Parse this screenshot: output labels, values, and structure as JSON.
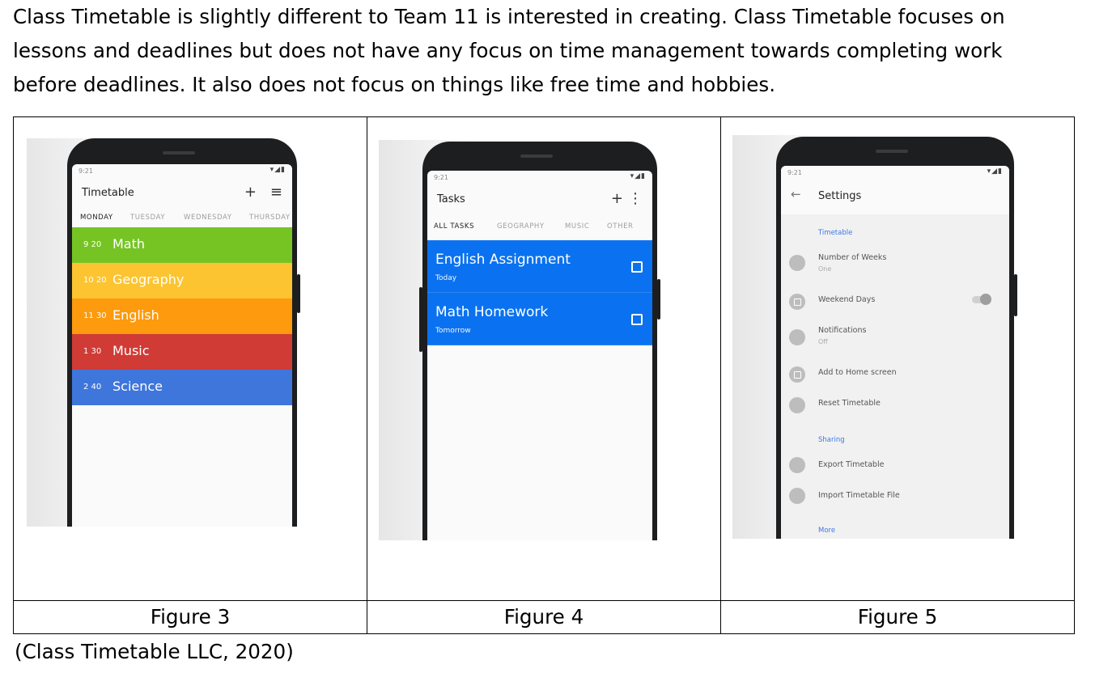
{
  "paragraph": {
    "line1": "Class Timetable is slightly different to Team 11 is interested in creating. Class Timetable focuses on",
    "line2": "lessons and deadlines but does not have any focus on time management towards completing work",
    "line3": "before deadlines. It also does not focus on things like free time and hobbies."
  },
  "figures": [
    {
      "label": "Figure 3",
      "status_time": "9:21",
      "app_title": "Timetable",
      "actions": [
        "+",
        "≡"
      ],
      "tabs": [
        "MONDAY",
        "TUESDAY",
        "WEDNESDAY",
        "THURSDAY"
      ],
      "lessons": [
        {
          "time": "9 20",
          "subject": "Math",
          "color": "#76c424"
        },
        {
          "time": "10 20",
          "subject": "Geography",
          "color": "#fcc431"
        },
        {
          "time": "11 30",
          "subject": "English",
          "color": "#fd9a0d"
        },
        {
          "time": "1 30",
          "subject": "Music",
          "color": "#d03b36"
        },
        {
          "time": "2 40",
          "subject": "Science",
          "color": "#3f76dc"
        }
      ]
    },
    {
      "label": "Figure 4",
      "status_time": "9:21",
      "app_title": "Tasks",
      "actions": [
        "+",
        "⋮"
      ],
      "tabs": [
        "ALL TASKS",
        "GEOGRAPHY",
        "MUSIC",
        "OTHER"
      ],
      "tasks": [
        {
          "name": "English Assignment",
          "due": "Today"
        },
        {
          "name": "Math Homework",
          "due": "Tomorrow"
        }
      ]
    },
    {
      "label": "Figure 5",
      "status_time": "9:21",
      "app_title": "Settings",
      "back": "←",
      "sections": [
        {
          "header": "Timetable"
        },
        {
          "header": "Sharing"
        },
        {
          "header": "More"
        }
      ],
      "items": [
        {
          "title": "Number of Weeks",
          "sub": "One"
        },
        {
          "title": "Weekend Days",
          "sub": ""
        },
        {
          "title": "Notifications",
          "sub": "Off"
        },
        {
          "title": "Add to Home screen",
          "sub": ""
        },
        {
          "title": "Reset Timetable",
          "sub": ""
        },
        {
          "title": "Export Timetable",
          "sub": ""
        },
        {
          "title": "Import Timetable File",
          "sub": ""
        }
      ]
    }
  ],
  "citation": "(Class Timetable LLC, 2020)"
}
